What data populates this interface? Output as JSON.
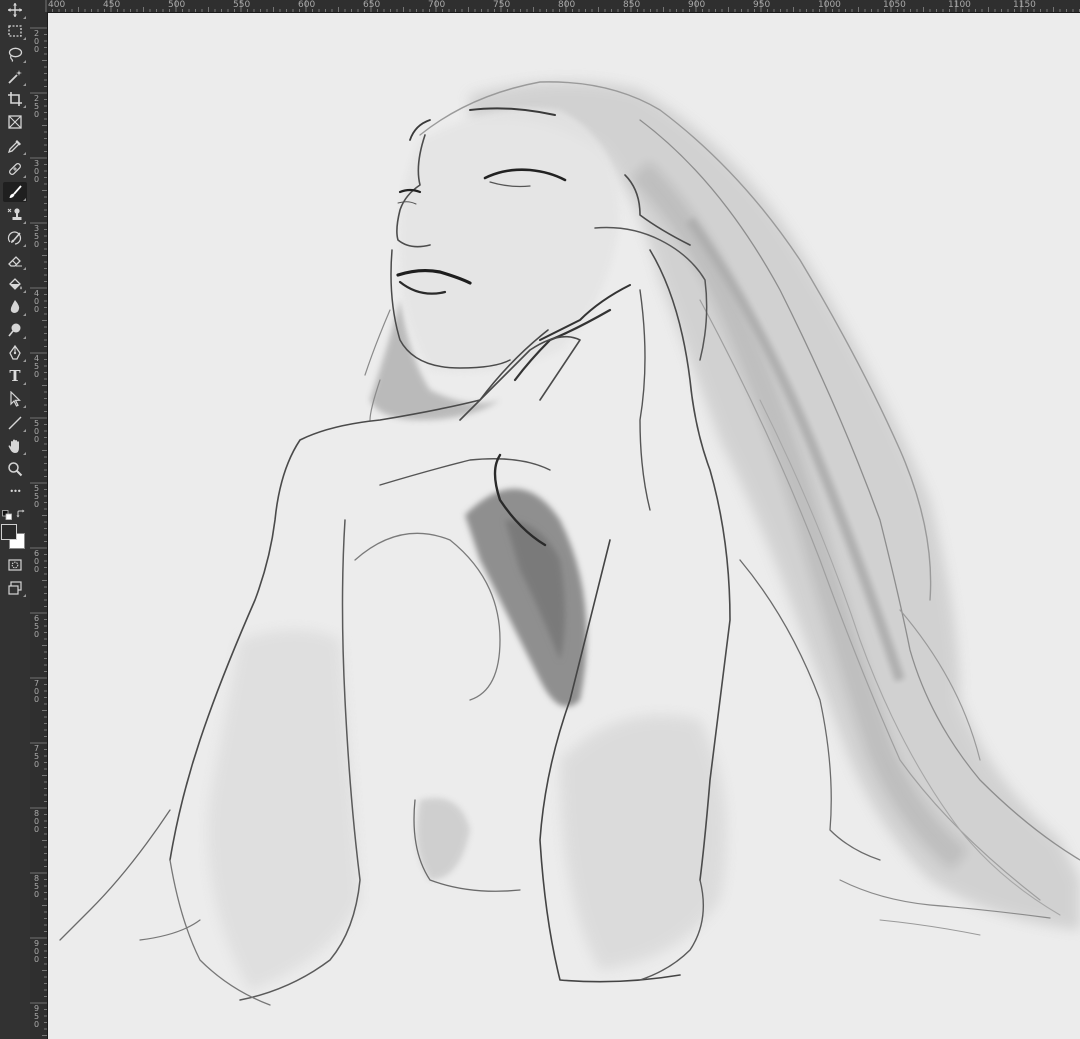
{
  "app": "Photoshop",
  "canvas": {
    "background": "#ececec",
    "subject": "sketch-woman-portrait"
  },
  "ruler_top": {
    "labels": [
      "400",
      "450",
      "500",
      "550",
      "600",
      "650",
      "700",
      "750",
      "800",
      "850",
      "900",
      "950",
      "1000",
      "1050",
      "1100",
      "1150"
    ]
  },
  "ruler_left": {
    "labels": [
      "200",
      "250",
      "300",
      "350",
      "400",
      "450",
      "500",
      "550",
      "600",
      "650",
      "700",
      "750",
      "800",
      "850",
      "900",
      "950"
    ]
  },
  "toolbar": {
    "tools": [
      {
        "name": "move-tool",
        "icon": "move-icon"
      },
      {
        "name": "marquee-tool",
        "icon": "rect-marquee-icon"
      },
      {
        "name": "lasso-tool",
        "icon": "lasso-icon"
      },
      {
        "name": "magic-wand-tool",
        "icon": "magic-wand-icon"
      },
      {
        "name": "crop-tool",
        "icon": "crop-icon"
      },
      {
        "name": "frame-tool",
        "icon": "frame-icon"
      },
      {
        "name": "eyedropper-tool",
        "icon": "eyedropper-icon"
      },
      {
        "name": "healing-brush-tool",
        "icon": "bandage-icon"
      },
      {
        "name": "brush-tool",
        "icon": "brush-icon",
        "active": true
      },
      {
        "name": "clone-stamp-tool",
        "icon": "stamp-icon"
      },
      {
        "name": "history-brush-tool",
        "icon": "history-brush-icon"
      },
      {
        "name": "eraser-tool",
        "icon": "eraser-icon"
      },
      {
        "name": "paint-bucket-tool",
        "icon": "bucket-icon"
      },
      {
        "name": "blur-tool",
        "icon": "blur-icon"
      },
      {
        "name": "dodge-tool",
        "icon": "dodge-icon"
      },
      {
        "name": "pen-tool",
        "icon": "pen-icon"
      },
      {
        "name": "type-tool",
        "icon": "type-icon"
      },
      {
        "name": "path-selection-tool",
        "icon": "arrow-icon"
      },
      {
        "name": "line-tool",
        "icon": "line-icon"
      },
      {
        "name": "hand-tool",
        "icon": "hand-icon"
      },
      {
        "name": "zoom-tool",
        "icon": "zoom-icon"
      },
      {
        "name": "more-tools",
        "icon": "ellipsis-icon"
      }
    ],
    "type_glyph": "T",
    "ellipsis_glyph": "•••",
    "foreground_color": "#2a2a2a",
    "background_color": "#ffffff"
  }
}
